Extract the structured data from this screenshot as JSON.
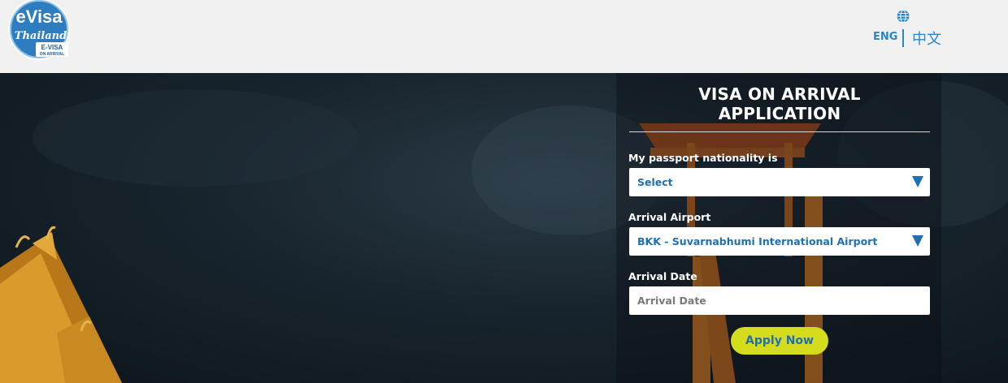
{
  "header": {
    "logo": {
      "text_main": "eVisa",
      "text_script": "Thailand",
      "text_sub1": "E-VISA",
      "text_sub2": "ON ARRIVAL"
    },
    "language": {
      "icon": "globe-icon",
      "eng_label": "ENG",
      "chinese_label": "中文",
      "color": "#2c86c6"
    }
  },
  "form": {
    "title_line1": "VISA ON ARRIVAL",
    "title_line2": "APPLICATION",
    "nationality_label": "My passport nationality is",
    "nationality_value": "Select",
    "airport_label": "Arrival Airport",
    "airport_value": "BKK - Suvarnabhumi International Airport",
    "date_label": "Arrival Date",
    "date_placeholder": "Arrival Date",
    "apply_label": "Apply Now",
    "accent_color": "#1f6fb5",
    "button_color": "#d5dc1e"
  }
}
